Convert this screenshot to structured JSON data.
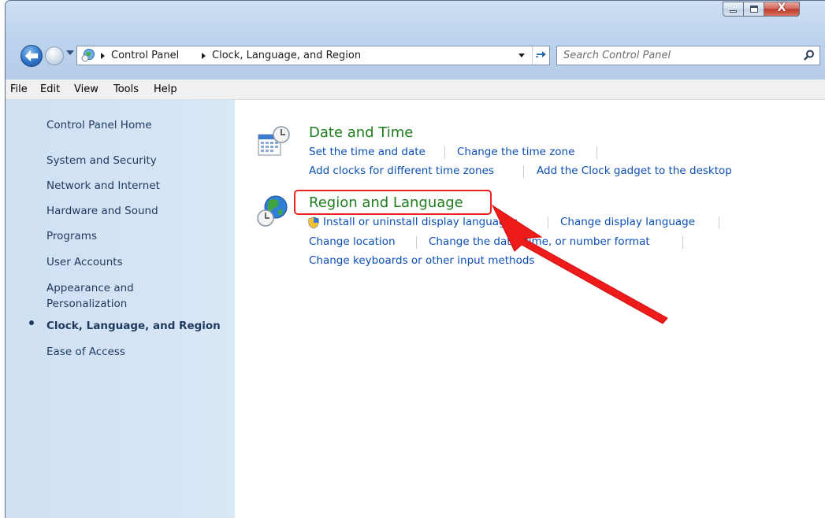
{
  "window": {
    "close_glyph": "X",
    "min_glyph": "–",
    "max_glyph": "□"
  },
  "address": {
    "crumbs": [
      "Control Panel",
      "Clock, Language, and Region"
    ]
  },
  "search": {
    "placeholder": "Search Control Panel"
  },
  "menu": {
    "items": [
      "File",
      "Edit",
      "View",
      "Tools",
      "Help"
    ]
  },
  "sidebar": {
    "items": [
      {
        "label": "Control Panel Home"
      },
      {
        "label": "System and Security"
      },
      {
        "label": "Network and Internet"
      },
      {
        "label": "Hardware and Sound"
      },
      {
        "label": "Programs"
      },
      {
        "label": "User Accounts"
      },
      {
        "label": "Appearance and"
      },
      {
        "label": "Personalization"
      },
      {
        "label": "Clock, Language, and Region"
      },
      {
        "label": "Ease of Access"
      }
    ]
  },
  "categories": [
    {
      "title": "Date and Time",
      "links": [
        "Set the time and date",
        "Change the time zone",
        "Add clocks for different time zones",
        "Add the Clock gadget to the desktop"
      ]
    },
    {
      "title": "Region and Language",
      "links": [
        "Install or uninstall display languages",
        "Change display language",
        "Change location",
        "Change the date, time, or number format",
        "Change keyboards or other input methods"
      ]
    }
  ],
  "colors": {
    "link": "#0b4fb5",
    "category_title": "#1e7d1e",
    "annotation": "#ee2121",
    "sidebar_bg": "#d4e3f4"
  }
}
